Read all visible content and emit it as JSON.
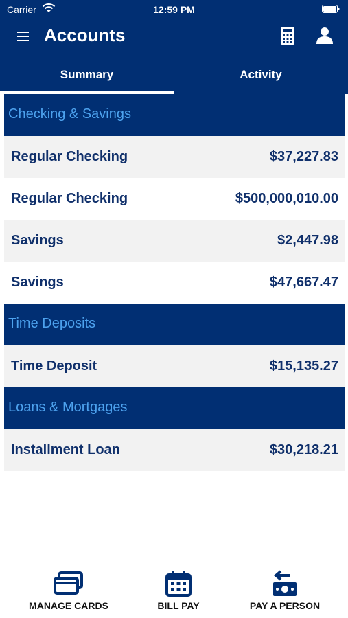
{
  "status_bar": {
    "carrier": "Carrier",
    "time": "12:59 PM"
  },
  "nav": {
    "title": "Accounts"
  },
  "tabs": [
    {
      "label": "Summary",
      "selected": true
    },
    {
      "label": "Activity",
      "selected": false
    }
  ],
  "sections": [
    {
      "title": "Checking & Savings",
      "accounts": [
        {
          "name": "Regular Checking",
          "balance": "$37,227.83"
        },
        {
          "name": "Regular Checking",
          "balance": "$500,000,010.00"
        },
        {
          "name": "Savings",
          "balance": "$2,447.98"
        },
        {
          "name": "Savings",
          "balance": "$47,667.47"
        }
      ]
    },
    {
      "title": "Time Deposits",
      "accounts": [
        {
          "name": "Time Deposit",
          "balance": "$15,135.27"
        }
      ]
    },
    {
      "title": "Loans & Mortgages",
      "accounts": [
        {
          "name": "Installment Loan",
          "balance": "$30,218.21"
        }
      ]
    }
  ],
  "bottom_actions": [
    {
      "label": "MANAGE CARDS",
      "icon": "cards-icon"
    },
    {
      "label": "BILL PAY",
      "icon": "calendar-icon"
    },
    {
      "label": "PAY A PERSON",
      "icon": "pay-person-icon"
    }
  ],
  "colors": {
    "header_bg": "#012f73",
    "section_text": "#4da2ee",
    "account_text": "#10306b",
    "row_shaded": "#f2f2f2"
  }
}
